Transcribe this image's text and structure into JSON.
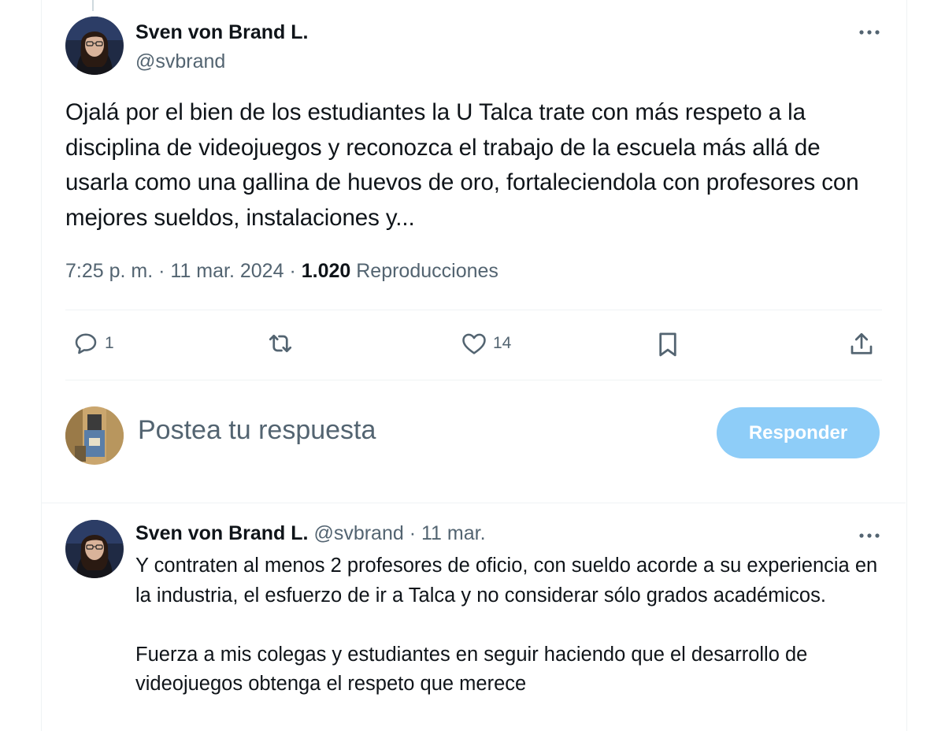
{
  "main_tweet": {
    "author_name": "Sven von Brand L.",
    "author_handle": "@svbrand",
    "text": "Ojalá por el bien de los estudiantes la U Talca trate con más respeto a la disciplina de videojuegos y reconozca el trabajo de la escuela más allá de usarla como una gallina de huevos de oro, fortaleciendola con profesores con mejores sueldos, instalaciones y...",
    "time": "7:25 p. m.",
    "dot": "·",
    "date": "11 mar. 2024",
    "views": "1.020",
    "views_label": "Reproducciones",
    "actions": {
      "replies": "1",
      "retweets": "",
      "likes": "14"
    }
  },
  "compose": {
    "placeholder": "Postea tu respuesta",
    "button_label": "Responder"
  },
  "reply_tweet": {
    "author_name": "Sven von Brand L.",
    "author_handle": "@svbrand",
    "dot": "·",
    "date": "11 mar.",
    "paragraphs": [
      "Y contraten al menos 2 profesores de oficio, con sueldo acorde a su experiencia en la industria, el esfuerzo de ir a Talca y no considerar sólo grados académicos.",
      "Fuerza a mis colegas y estudiantes en seguir haciendo que el desarrollo de videojuegos obtenga el respeto que merece"
    ]
  },
  "colors": {
    "primary_text": "#0f1419",
    "secondary_text": "#536471",
    "reply_button_bg": "#8ecdf8",
    "border": "#eff3f4"
  },
  "icons": {
    "reply": "speech-bubble-icon",
    "retweet": "repost-arrows-icon",
    "like": "heart-icon",
    "bookmark": "bookmark-icon",
    "share": "upload-share-icon",
    "more": "more-dots-icon"
  }
}
